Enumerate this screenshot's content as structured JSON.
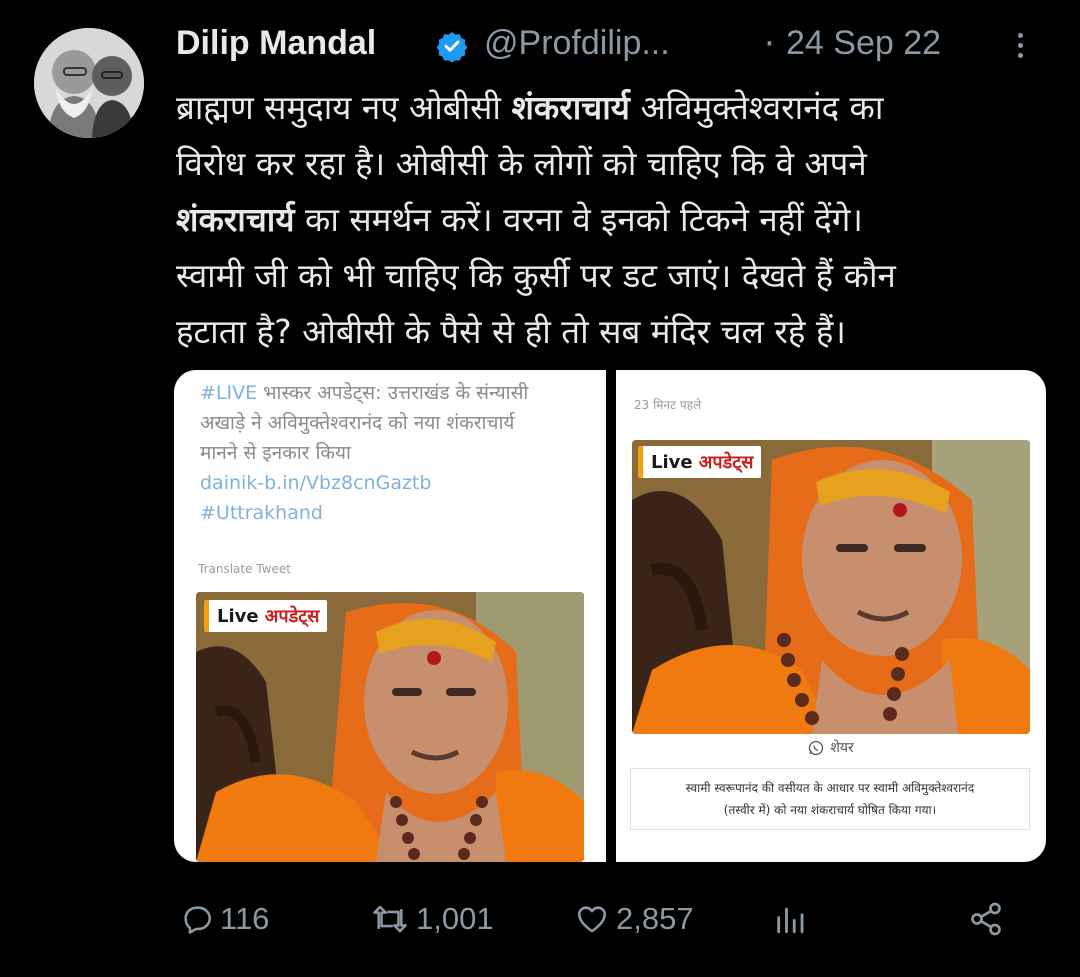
{
  "tweet": {
    "author_name": "Dilip Mandal",
    "handle": "@Profdilip...",
    "separator": "·",
    "date": "24 Sep 22",
    "text_lines": [
      {
        "pre": "ब्राह्मण समुदाय नए ओबीसी ",
        "bold": "शंकराचार्य",
        "post": " अविमुक्तेश्वरानंद का"
      },
      {
        "pre": "विरोध कर रहा है। ओबीसी के लोगों को चाहिए कि वे अपने",
        "bold": "",
        "post": ""
      },
      {
        "pre": "",
        "bold": "शंकराचार्य",
        "post": " का समर्थन करें। वरना वे इनको टिकने नहीं देंगे।"
      },
      {
        "pre": "स्वामी जी को भी चाहिए कि कुर्सी पर डट जाएं। देखते हैं कौन",
        "bold": "",
        "post": ""
      },
      {
        "pre": "हटाता है? ओबीसी के पैसे से ही तो सब मंदिर चल रहे हैं।",
        "bold": "",
        "post": ""
      }
    ]
  },
  "media_left": {
    "hashtag_live": "#LIVE",
    "line1_rest": " भास्कर अपडेट्स: उत्तराखंड के संन्यासी",
    "line2": "अखाड़े ने अविमुक्तेश्वरानंद को नया शंकराचार्य",
    "line3": "मानने से इनकार किया",
    "link": "dainik-b.in/Vbz8cnGaztb",
    "hashtag": "#Uttrakhand",
    "translate": "Translate Tweet",
    "badge_live": "Live",
    "badge_updates": "अपडेट्स"
  },
  "media_right": {
    "time_ago": "23 मिनट पहले",
    "badge_live": "Live",
    "badge_updates": "अपडेट्स",
    "share_label": "शेयर",
    "caption_line1": "स्वामी स्वरूपानंद की वसीयत के आधार पर स्वामी  अविमुक्तेश्वरानंद",
    "caption_line2": "(तस्वीर में) को नया शंकराचार्य घोषित किया गया।"
  },
  "actions": {
    "replies": "116",
    "retweets": "1,001",
    "likes": "2,857"
  },
  "colors": {
    "background": "#000000",
    "text": "#e7e9ea",
    "muted": "#8b98a5",
    "verified": "#1d9bf0",
    "saffron": "#f07a10"
  },
  "icons": [
    "verified-badge-icon",
    "more-icon",
    "reply-icon",
    "retweet-icon",
    "like-icon",
    "views-icon",
    "share-icon",
    "whatsapp-icon"
  ]
}
